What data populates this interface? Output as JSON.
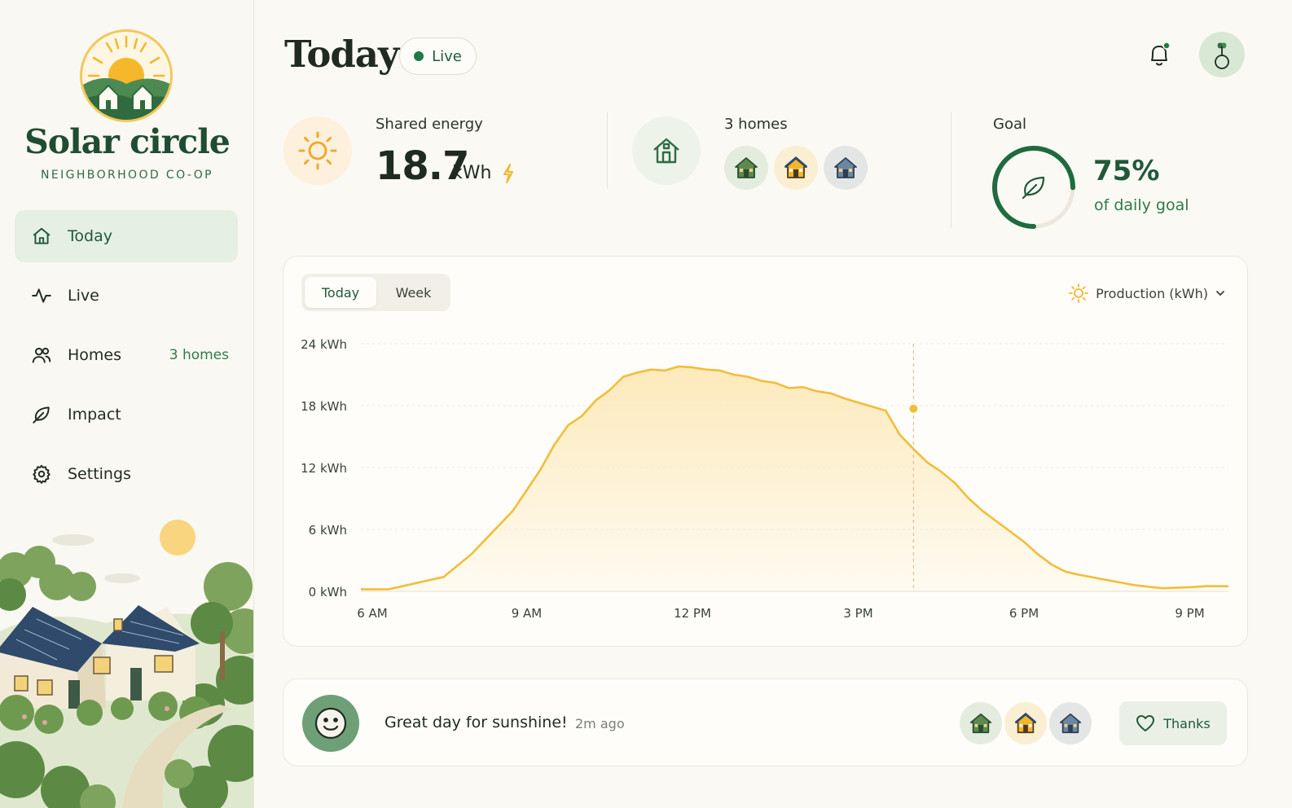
{
  "brand": {
    "name": "Solar circle",
    "subtitle": "NEIGHBORHOOD CO-OP"
  },
  "nav": {
    "items": [
      {
        "label": "Today",
        "icon": "home-icon",
        "active": true,
        "badge": ""
      },
      {
        "label": "Live",
        "icon": "activity-icon",
        "active": false,
        "badge": ""
      },
      {
        "label": "Homes",
        "icon": "users-icon",
        "active": false,
        "badge": "3 homes"
      },
      {
        "label": "Impact",
        "icon": "leaf-icon",
        "active": false,
        "badge": ""
      },
      {
        "label": "Settings",
        "icon": "gear-icon",
        "active": false,
        "badge": ""
      }
    ]
  },
  "header": {
    "title": "Today",
    "live_label": "Live"
  },
  "stats": {
    "shared_energy": {
      "label": "Shared energy",
      "value": "18.7",
      "unit": "kWh"
    },
    "homes": {
      "label": "3 homes",
      "icons": [
        "house-green-icon",
        "house-yellow-icon",
        "house-blue-icon"
      ]
    },
    "goal": {
      "label": "Goal",
      "value": "75%",
      "fraction": 0.75,
      "subtitle": "of daily goal"
    }
  },
  "chart_controls": {
    "tabs": [
      "Today",
      "Week"
    ],
    "active_tab": "Today",
    "metric": "Production (kWh)"
  },
  "chart_data": {
    "type": "area",
    "title": "",
    "xlabel": "",
    "ylabel": "",
    "x_ticks": [
      "6 AM",
      "9 AM",
      "12 PM",
      "3 PM",
      "6 PM",
      "9 PM"
    ],
    "y_ticks": [
      "0 kWh",
      "6 kWh",
      "12 kWh",
      "18 kWh",
      "24 kWh"
    ],
    "xlim": [
      6,
      21.7
    ],
    "ylim": [
      0,
      24
    ],
    "series": [
      {
        "name": "",
        "x": [
          6.0,
          6.5,
          6.75,
          7.0,
          7.5,
          7.75,
          8.0,
          8.25,
          8.5,
          8.75,
          9.0,
          9.25,
          9.5,
          9.75,
          10.0,
          10.25,
          10.5,
          10.75,
          11.0,
          11.25,
          11.5,
          11.75,
          12.0,
          12.25,
          12.5,
          12.75,
          13.0,
          13.25,
          13.5,
          13.75,
          14.0,
          14.25,
          14.5,
          14.75,
          15.0,
          15.25,
          15.5,
          15.75,
          16.0,
          16.25,
          16.5,
          16.75,
          17.0,
          17.25,
          17.5,
          17.75,
          18.0,
          18.25,
          18.5,
          18.75,
          19.0,
          19.5,
          20.0,
          20.5,
          21.0,
          21.3,
          21.7
        ],
        "values": [
          0.2,
          0.2,
          0.5,
          0.8,
          1.4,
          2.5,
          3.6,
          5.0,
          6.4,
          7.8,
          9.8,
          11.8,
          14.2,
          16.1,
          17.0,
          18.5,
          19.5,
          20.8,
          21.2,
          21.5,
          21.4,
          21.8,
          21.7,
          21.5,
          21.4,
          21.0,
          20.8,
          20.4,
          20.2,
          19.7,
          19.8,
          19.4,
          19.2,
          18.7,
          18.3,
          17.9,
          17.5,
          15.2,
          13.8,
          12.5,
          11.6,
          10.5,
          9.0,
          7.8,
          6.8,
          5.8,
          4.8,
          3.6,
          2.6,
          1.9,
          1.6,
          1.1,
          0.6,
          0.3,
          0.4,
          0.5,
          0.5
        ]
      }
    ],
    "marker": {
      "x": 16.0,
      "y": 17.7
    },
    "line_color": "#f2bd3a",
    "fill_color": "#fde9b8",
    "grid": true
  },
  "message": {
    "text": "Great day for sunshine!",
    "time": "2m ago",
    "reactors": [
      "house-green-icon",
      "house-yellow-icon",
      "house-blue-icon"
    ],
    "button_label": "Thanks"
  },
  "colors": {
    "brand_green": "#1f4d32",
    "accent_green": "#2f7a4a",
    "sun_yellow": "#f2bd3a",
    "background": "#fbf9f3"
  }
}
